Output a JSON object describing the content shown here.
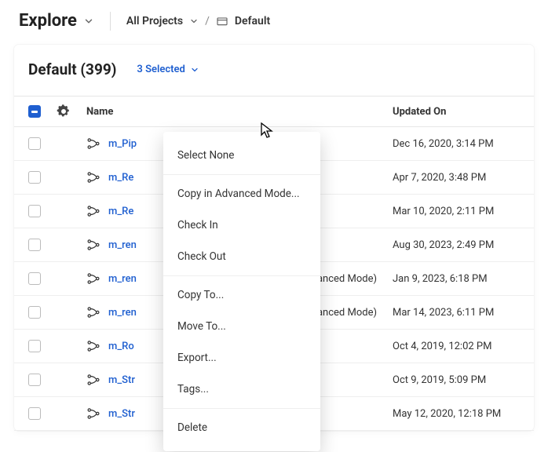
{
  "topbar": {
    "explore": "Explore",
    "project_scope": "All Projects",
    "breadcrumb_sep": "/",
    "folder": "Default"
  },
  "panel": {
    "title": "Default (399)",
    "selection_label": "3 Selected"
  },
  "table": {
    "headers": {
      "name": "Name",
      "updated": "Updated On"
    },
    "rows": [
      {
        "name": "m_Pip",
        "updated": "Dec 16, 2020, 3:14 PM"
      },
      {
        "name": "m_Re",
        "updated": "Apr 7, 2020, 3:48 PM"
      },
      {
        "name": "m_Re",
        "updated": "Mar 10, 2020, 2:11 PM"
      },
      {
        "name": "m_ren",
        "updated": "Aug 30, 2023, 2:49 PM"
      },
      {
        "name": "m_ren",
        "suffix": "Advanced Mode)",
        "updated": "Jan 9, 2023, 6:18 PM"
      },
      {
        "name": "m_ren",
        "suffix": "Advanced Mode)",
        "updated": "Mar 14, 2023, 6:11 PM"
      },
      {
        "name": "m_Ro",
        "updated": "Oct 4, 2019, 12:02 PM"
      },
      {
        "name": "m_Str",
        "updated": "Oct 9, 2019, 5:09 PM"
      },
      {
        "name": "m_Str",
        "updated": "May 12, 2020, 12:18 PM"
      }
    ]
  },
  "menu": {
    "select_none": "Select None",
    "copy_advanced": "Copy in Advanced Mode...",
    "check_in": "Check In",
    "check_out": "Check Out",
    "copy_to": "Copy To...",
    "move_to": "Move To...",
    "export": "Export...",
    "tags": "Tags...",
    "delete": "Delete"
  }
}
